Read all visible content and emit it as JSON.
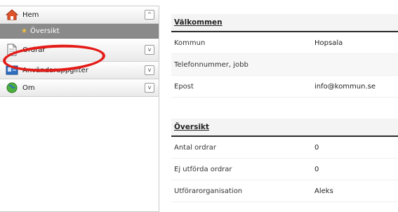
{
  "sidebar": {
    "home": {
      "label": "Hem",
      "icon": "home-icon",
      "toggle": "^"
    },
    "sub": {
      "label": "Översikt",
      "icon": "star-icon"
    },
    "orders": {
      "label": "Ordrar",
      "icon": "document-icon",
      "toggle": "v"
    },
    "third": {
      "label": "Användaruppgifter",
      "icon": "card-icon",
      "toggle": "v"
    },
    "about": {
      "label": "Om",
      "icon": "globe-icon",
      "toggle": "v"
    }
  },
  "welcome": {
    "title": "Välkommen",
    "rows": [
      {
        "key": "Kommun",
        "value": "Hopsala"
      },
      {
        "key": "Telefonnummer, jobb",
        "value": ""
      },
      {
        "key": "Epost",
        "value": "info@kommun.se"
      }
    ]
  },
  "overview": {
    "title": "Översikt",
    "rows": [
      {
        "key": "Antal ordrar",
        "value": "0"
      },
      {
        "key": "Ej utförda ordrar",
        "value": "0"
      },
      {
        "key": "Utförarorganisation",
        "value": "Aleks"
      }
    ]
  },
  "colors": {
    "highlight": "#e41b17",
    "subitem_bg": "#8a8a8a",
    "star": "#f3c13a"
  }
}
